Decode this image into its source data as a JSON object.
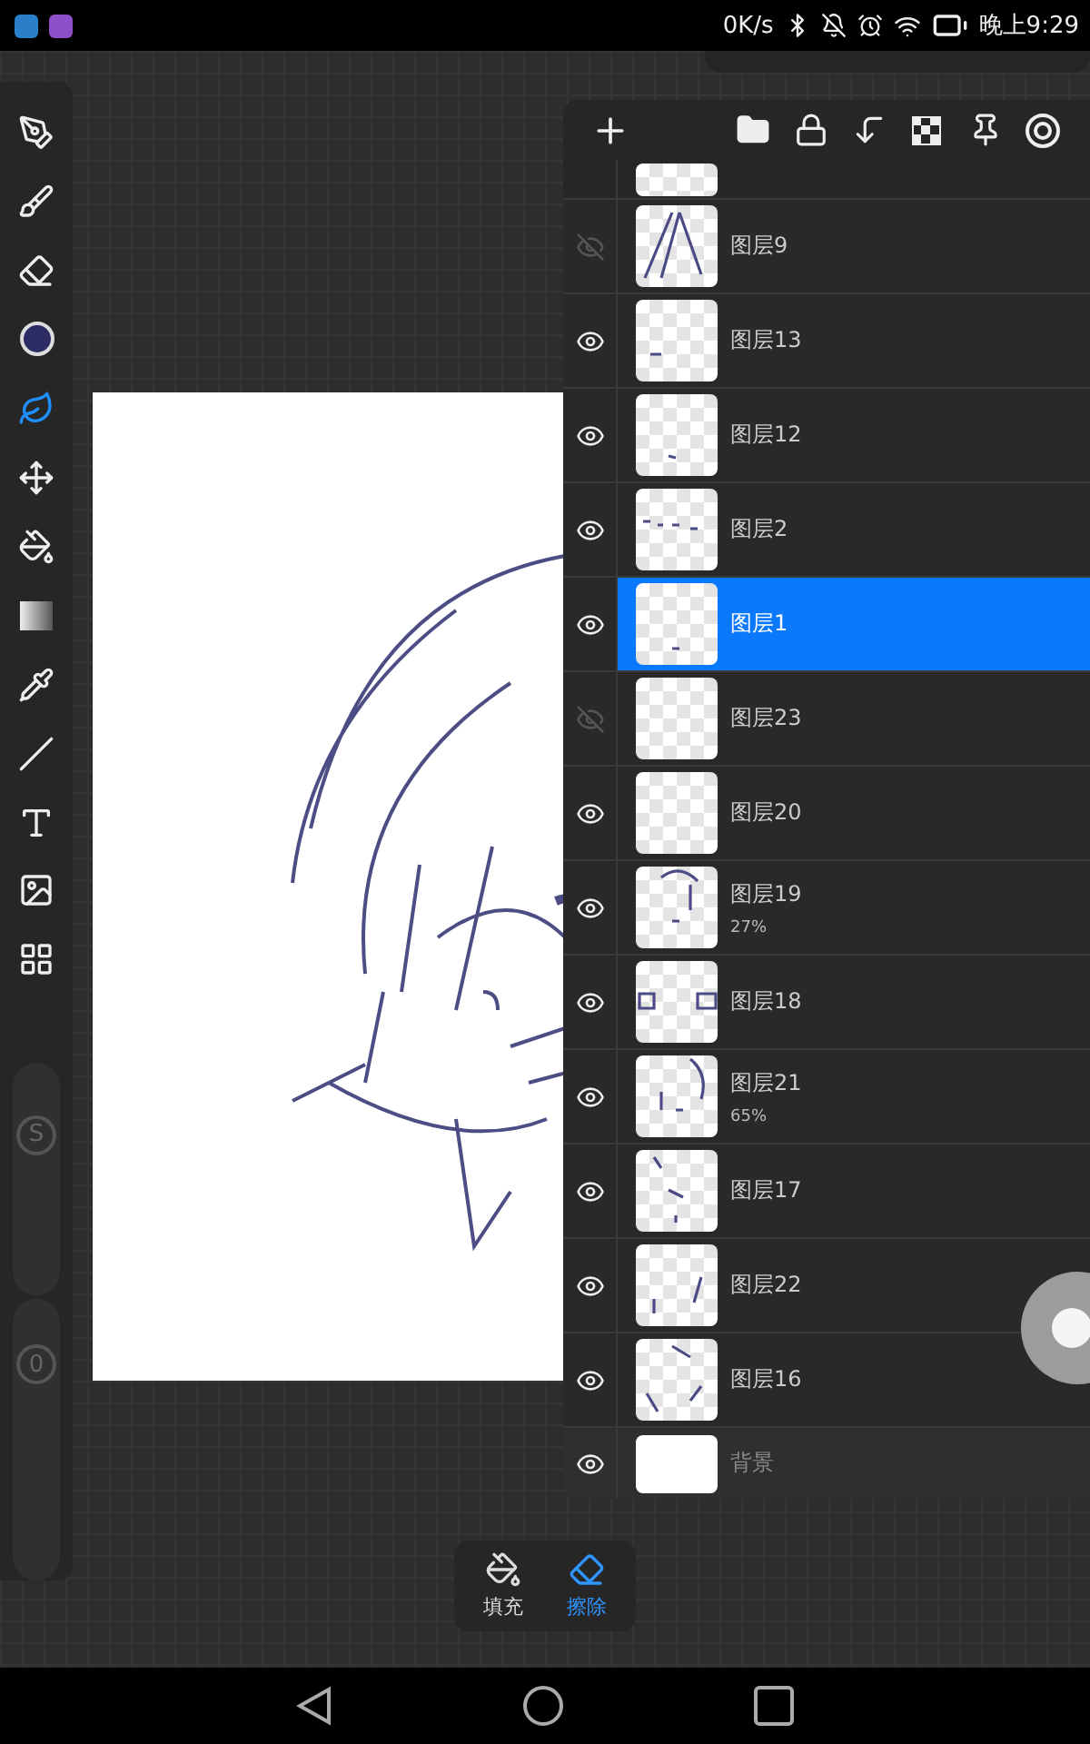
{
  "status_bar": {
    "net_speed": "0K/s",
    "time": "晚上9:29"
  },
  "tools": [
    {
      "kind": "pen",
      "selected": false
    },
    {
      "kind": "smudge",
      "selected": false
    },
    {
      "kind": "eraser",
      "selected": false
    },
    {
      "kind": "color",
      "selected": false,
      "color": "#2c2b63"
    },
    {
      "kind": "lasso",
      "selected": true
    },
    {
      "kind": "transform",
      "selected": false
    },
    {
      "kind": "fill",
      "selected": false
    },
    {
      "kind": "gradient",
      "selected": false
    },
    {
      "kind": "eyedropper",
      "selected": false
    },
    {
      "kind": "line",
      "selected": false
    },
    {
      "kind": "text",
      "selected": false
    },
    {
      "kind": "filter",
      "selected": false
    },
    {
      "kind": "grid",
      "selected": false
    }
  ],
  "sliders": [
    {
      "label": "S",
      "level": 0.74
    },
    {
      "label": "0",
      "level": 0.82
    }
  ],
  "layers": [
    {
      "kind": "layer",
      "name": "图层9",
      "visible": false,
      "selected": false
    },
    {
      "kind": "layer",
      "name": "图层13",
      "visible": true,
      "selected": false
    },
    {
      "kind": "layer",
      "name": "图层12",
      "visible": true,
      "selected": false
    },
    {
      "kind": "layer",
      "name": "图层2",
      "visible": true,
      "selected": false
    },
    {
      "kind": "layer",
      "name": "图层1",
      "visible": true,
      "selected": true
    },
    {
      "kind": "layer",
      "name": "图层23",
      "visible": false,
      "selected": false
    },
    {
      "kind": "layer",
      "name": "图层20",
      "visible": true,
      "selected": false
    },
    {
      "kind": "layer",
      "name": "图层19",
      "opacity": "27%",
      "visible": true,
      "selected": false
    },
    {
      "kind": "layer",
      "name": "图层18",
      "visible": true,
      "selected": false
    },
    {
      "kind": "layer",
      "name": "图层21",
      "opacity": "65%",
      "visible": true,
      "selected": false
    },
    {
      "kind": "layer",
      "name": "图层17",
      "visible": true,
      "selected": false
    },
    {
      "kind": "layer",
      "name": "图层22",
      "visible": true,
      "selected": false
    },
    {
      "kind": "layer",
      "name": "图层16",
      "visible": true,
      "selected": false
    },
    {
      "kind": "background",
      "name": "背景",
      "visible": true,
      "selected": false
    }
  ],
  "fill_popup": [
    {
      "kind": "fill",
      "label": "填充",
      "selected": false
    },
    {
      "kind": "erase",
      "label": "擦除",
      "selected": true
    }
  ]
}
